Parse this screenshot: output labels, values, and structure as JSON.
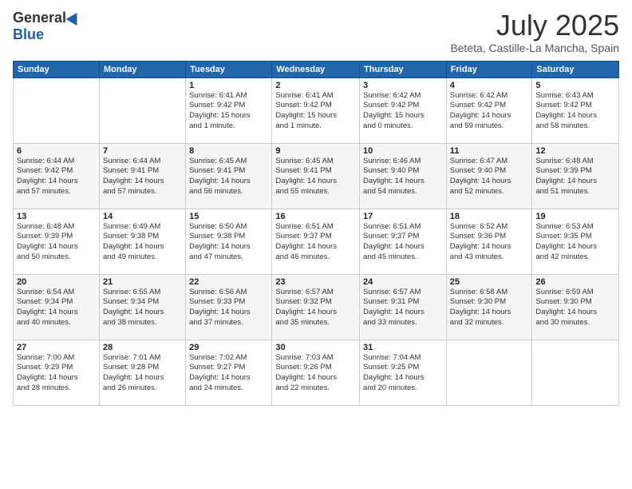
{
  "logo": {
    "general": "General",
    "blue": "Blue"
  },
  "header": {
    "title": "July 2025",
    "subtitle": "Beteta, Castille-La Mancha, Spain"
  },
  "weekdays": [
    "Sunday",
    "Monday",
    "Tuesday",
    "Wednesday",
    "Thursday",
    "Friday",
    "Saturday"
  ],
  "weeks": [
    [
      {
        "day": "",
        "info": ""
      },
      {
        "day": "",
        "info": ""
      },
      {
        "day": "1",
        "info": "Sunrise: 6:41 AM\nSunset: 9:42 PM\nDaylight: 15 hours\nand 1 minute."
      },
      {
        "day": "2",
        "info": "Sunrise: 6:41 AM\nSunset: 9:42 PM\nDaylight: 15 hours\nand 1 minute."
      },
      {
        "day": "3",
        "info": "Sunrise: 6:42 AM\nSunset: 9:42 PM\nDaylight: 15 hours\nand 0 minutes."
      },
      {
        "day": "4",
        "info": "Sunrise: 6:42 AM\nSunset: 9:42 PM\nDaylight: 14 hours\nand 59 minutes."
      },
      {
        "day": "5",
        "info": "Sunrise: 6:43 AM\nSunset: 9:42 PM\nDaylight: 14 hours\nand 58 minutes."
      }
    ],
    [
      {
        "day": "6",
        "info": "Sunrise: 6:44 AM\nSunset: 9:42 PM\nDaylight: 14 hours\nand 57 minutes."
      },
      {
        "day": "7",
        "info": "Sunrise: 6:44 AM\nSunset: 9:41 PM\nDaylight: 14 hours\nand 57 minutes."
      },
      {
        "day": "8",
        "info": "Sunrise: 6:45 AM\nSunset: 9:41 PM\nDaylight: 14 hours\nand 56 minutes."
      },
      {
        "day": "9",
        "info": "Sunrise: 6:45 AM\nSunset: 9:41 PM\nDaylight: 14 hours\nand 55 minutes."
      },
      {
        "day": "10",
        "info": "Sunrise: 6:46 AM\nSunset: 9:40 PM\nDaylight: 14 hours\nand 54 minutes."
      },
      {
        "day": "11",
        "info": "Sunrise: 6:47 AM\nSunset: 9:40 PM\nDaylight: 14 hours\nand 52 minutes."
      },
      {
        "day": "12",
        "info": "Sunrise: 6:48 AM\nSunset: 9:39 PM\nDaylight: 14 hours\nand 51 minutes."
      }
    ],
    [
      {
        "day": "13",
        "info": "Sunrise: 6:48 AM\nSunset: 9:39 PM\nDaylight: 14 hours\nand 50 minutes."
      },
      {
        "day": "14",
        "info": "Sunrise: 6:49 AM\nSunset: 9:38 PM\nDaylight: 14 hours\nand 49 minutes."
      },
      {
        "day": "15",
        "info": "Sunrise: 6:50 AM\nSunset: 9:38 PM\nDaylight: 14 hours\nand 47 minutes."
      },
      {
        "day": "16",
        "info": "Sunrise: 6:51 AM\nSunset: 9:37 PM\nDaylight: 14 hours\nand 46 minutes."
      },
      {
        "day": "17",
        "info": "Sunrise: 6:51 AM\nSunset: 9:37 PM\nDaylight: 14 hours\nand 45 minutes."
      },
      {
        "day": "18",
        "info": "Sunrise: 6:52 AM\nSunset: 9:36 PM\nDaylight: 14 hours\nand 43 minutes."
      },
      {
        "day": "19",
        "info": "Sunrise: 6:53 AM\nSunset: 9:35 PM\nDaylight: 14 hours\nand 42 minutes."
      }
    ],
    [
      {
        "day": "20",
        "info": "Sunrise: 6:54 AM\nSunset: 9:34 PM\nDaylight: 14 hours\nand 40 minutes."
      },
      {
        "day": "21",
        "info": "Sunrise: 6:55 AM\nSunset: 9:34 PM\nDaylight: 14 hours\nand 38 minutes."
      },
      {
        "day": "22",
        "info": "Sunrise: 6:56 AM\nSunset: 9:33 PM\nDaylight: 14 hours\nand 37 minutes."
      },
      {
        "day": "23",
        "info": "Sunrise: 6:57 AM\nSunset: 9:32 PM\nDaylight: 14 hours\nand 35 minutes."
      },
      {
        "day": "24",
        "info": "Sunrise: 6:57 AM\nSunset: 9:31 PM\nDaylight: 14 hours\nand 33 minutes."
      },
      {
        "day": "25",
        "info": "Sunrise: 6:58 AM\nSunset: 9:30 PM\nDaylight: 14 hours\nand 32 minutes."
      },
      {
        "day": "26",
        "info": "Sunrise: 6:59 AM\nSunset: 9:30 PM\nDaylight: 14 hours\nand 30 minutes."
      }
    ],
    [
      {
        "day": "27",
        "info": "Sunrise: 7:00 AM\nSunset: 9:29 PM\nDaylight: 14 hours\nand 28 minutes."
      },
      {
        "day": "28",
        "info": "Sunrise: 7:01 AM\nSunset: 9:28 PM\nDaylight: 14 hours\nand 26 minutes."
      },
      {
        "day": "29",
        "info": "Sunrise: 7:02 AM\nSunset: 9:27 PM\nDaylight: 14 hours\nand 24 minutes."
      },
      {
        "day": "30",
        "info": "Sunrise: 7:03 AM\nSunset: 9:26 PM\nDaylight: 14 hours\nand 22 minutes."
      },
      {
        "day": "31",
        "info": "Sunrise: 7:04 AM\nSunset: 9:25 PM\nDaylight: 14 hours\nand 20 minutes."
      },
      {
        "day": "",
        "info": ""
      },
      {
        "day": "",
        "info": ""
      }
    ]
  ]
}
